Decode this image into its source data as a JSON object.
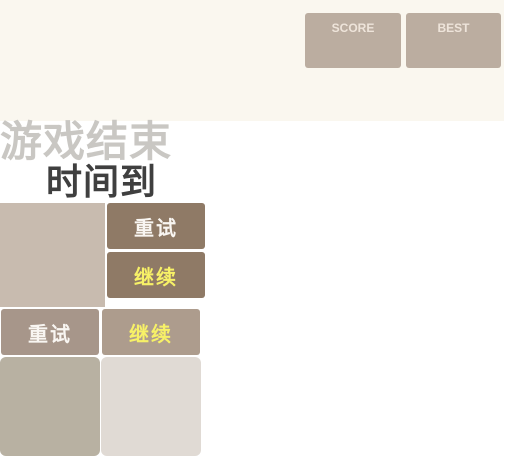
{
  "header": {
    "score_label": "SCORE",
    "best_label": "BEST"
  },
  "overlay": {
    "game_over_text": "游戏结束",
    "time_up_text": "时间到"
  },
  "buttons": {
    "retry_label": "重试",
    "continue_label": "继续"
  },
  "colors": {
    "header_bg": "#faf7ef",
    "score_box": "#bbada0",
    "button_primary": "#8f7a66",
    "continue_text": "#f7f167"
  }
}
